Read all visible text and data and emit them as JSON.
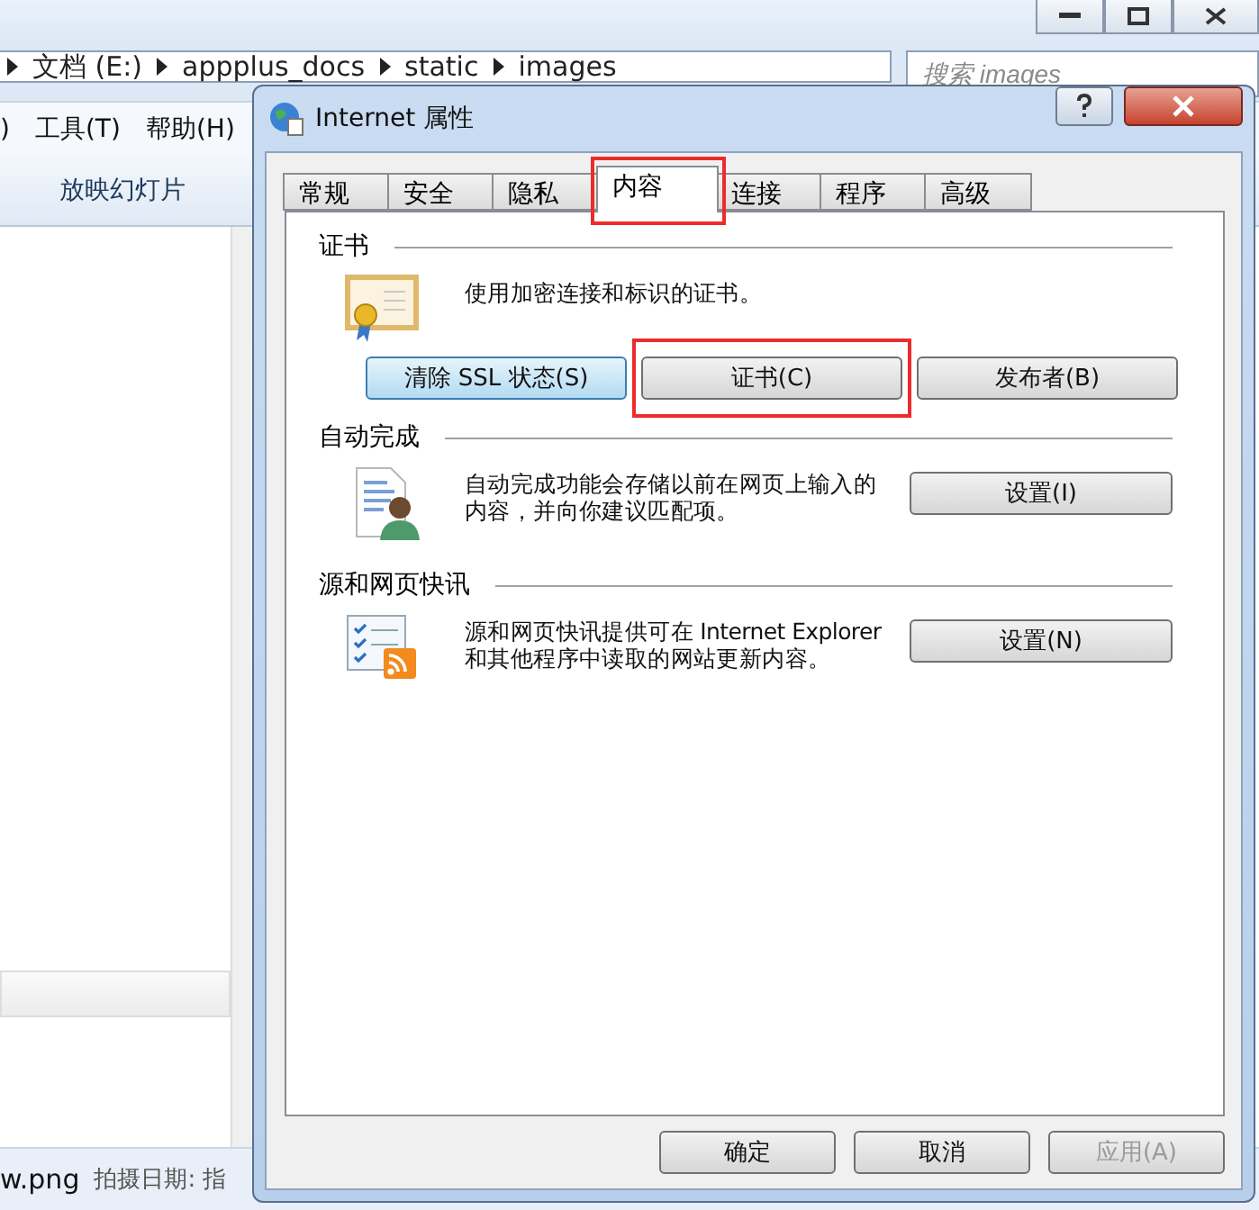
{
  "explorer": {
    "breadcrumb": [
      "文档 (E:)",
      "appplus_docs",
      "static",
      "images"
    ],
    "search": {
      "placeholder": "搜索 images"
    },
    "menu": [
      ")",
      "工具(T)",
      "帮助(H)"
    ],
    "toolbar": [
      "放映幻灯片"
    ],
    "status": {
      "file": "w.png",
      "detail": "拍摄日期: 指"
    }
  },
  "dialog": {
    "title": "Internet 属性",
    "tabs": [
      {
        "label": "常规",
        "selected": false,
        "highlighted": false
      },
      {
        "label": "安全",
        "selected": false,
        "highlighted": false
      },
      {
        "label": "隐私",
        "selected": false,
        "highlighted": false
      },
      {
        "label": "内容",
        "selected": true,
        "highlighted": true
      },
      {
        "label": "连接",
        "selected": false,
        "highlighted": false
      },
      {
        "label": "程序",
        "selected": false,
        "highlighted": false
      },
      {
        "label": "高级",
        "selected": false,
        "highlighted": false
      }
    ],
    "sections": [
      {
        "kind": "certificate",
        "title": "证书",
        "description": "使用加密连接和标识的证书。",
        "buttons": [
          {
            "label": "清除 SSL 状态(S)",
            "focused": true,
            "highlighted": false
          },
          {
            "label": "证书(C)",
            "focused": false,
            "highlighted": true
          },
          {
            "label": "发布者(B)",
            "focused": false,
            "highlighted": false
          }
        ]
      },
      {
        "kind": "autocomplete",
        "title": "自动完成",
        "description": "自动完成功能会存储以前在网页上输入的内容，并向你建议匹配项。",
        "buttons": [
          {
            "label": "设置(I)",
            "focused": false,
            "highlighted": false
          }
        ]
      },
      {
        "kind": "feeds",
        "title": "源和网页快讯",
        "description": "源和网页快讯提供可在 Internet Explorer 和其他程序中读取的网站更新内容。",
        "buttons": [
          {
            "label": "设置(N)",
            "focused": false,
            "highlighted": false
          }
        ]
      }
    ],
    "footer": [
      {
        "label": "确定",
        "disabled": false
      },
      {
        "label": "取消",
        "disabled": false
      },
      {
        "label": "应用(A)",
        "disabled": true
      }
    ]
  }
}
